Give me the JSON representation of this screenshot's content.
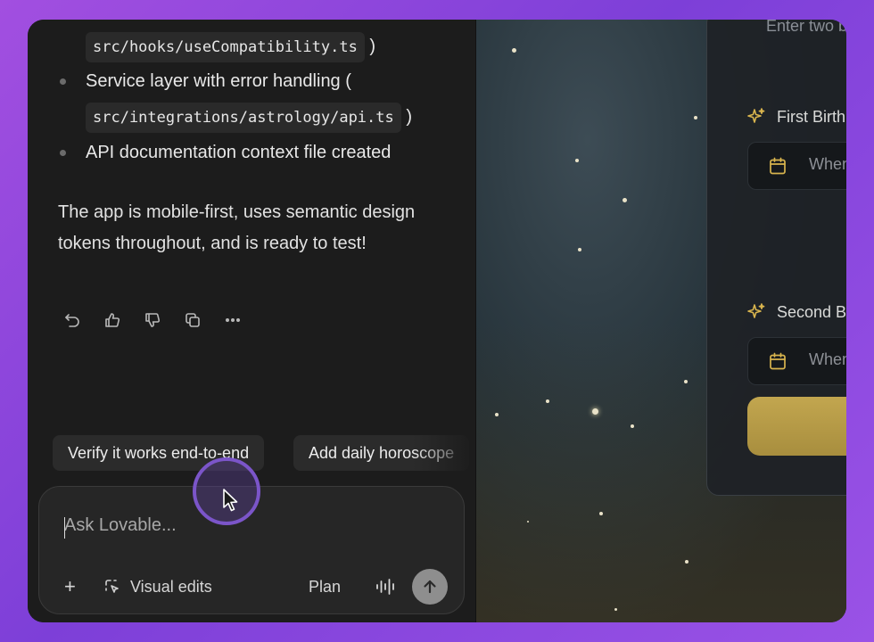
{
  "chat": {
    "bullets": [
      {
        "code": "src/hooks/useCompatibility.ts",
        "suffix": ")"
      },
      {
        "text": "Service layer with error handling (",
        "code": "src/integrations/astrology/api.ts",
        "suffix": ")"
      },
      {
        "text": "API documentation context file created"
      }
    ],
    "paragraph": "The app is mobile-first, uses semantic design tokens throughout, and is ready to test!",
    "actions": [
      "undo-icon",
      "thumbs-up-icon",
      "thumbs-down-icon",
      "copy-icon",
      "more-icon"
    ],
    "suggestions": [
      "Verify it works end-to-end",
      "Add daily horoscope"
    ]
  },
  "composer": {
    "placeholder": "Ask Lovable...",
    "add_label": "+",
    "visual_edits_label": "Visual edits",
    "plan_label": "Plan"
  },
  "preview": {
    "hint": "Enter two b",
    "first_label": "First Birth",
    "second_label": "Second B",
    "date_placeholder": "When",
    "accent_color": "#b89b45"
  }
}
